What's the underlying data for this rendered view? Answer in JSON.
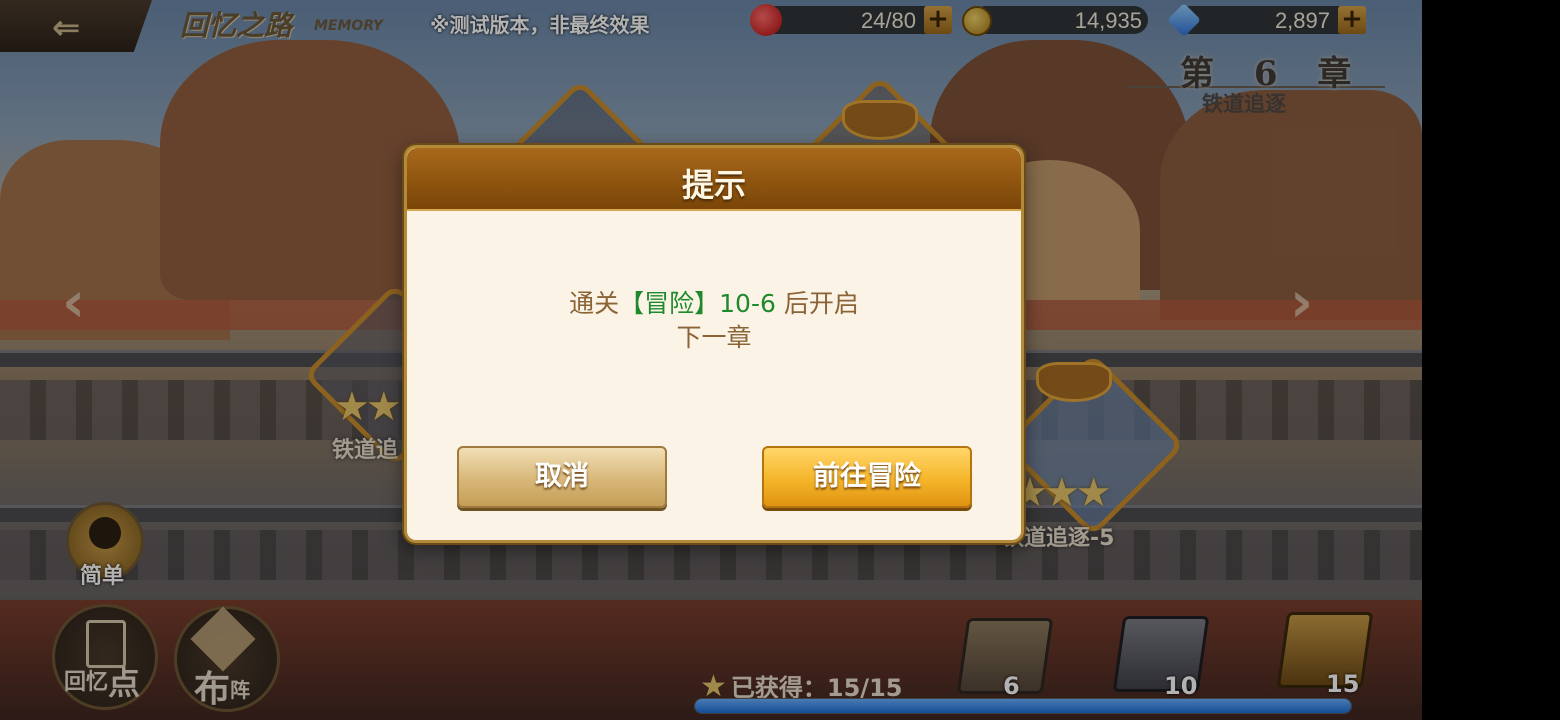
{
  "header": {
    "title": "回忆之路",
    "title_sub": "MEMORY",
    "test_notice": "※测试版本，非最终效果"
  },
  "resources": {
    "stamina": "24/80",
    "gold": "14,935",
    "gems": "2,897",
    "plus": "+"
  },
  "chapter": {
    "number": "第 6 章",
    "name": "铁道追逐"
  },
  "stages": [
    {
      "label": "铁道追",
      "stars": "★★"
    },
    {
      "label": "铁道追逐-5",
      "stars": "★★★"
    }
  ],
  "left_buttons": {
    "difficulty": "简单",
    "memory_a": "回忆",
    "memory_b": "点",
    "formation_a": "布",
    "formation_b": "阵"
  },
  "progress": {
    "earned_label": "已获得：15/15",
    "earned": 15,
    "total": 15,
    "chests": [
      "6",
      "10",
      "15"
    ]
  },
  "dialog": {
    "title": "提示",
    "msg_prefix": "通关",
    "msg_highlight": "【冒险】10-6",
    "msg_suffix": " 后开启",
    "msg_line2": "下一章",
    "cancel_label": "取消",
    "go_label": "前往冒险"
  },
  "nav": {
    "left": "‹",
    "right": "›",
    "back": "⇐"
  }
}
